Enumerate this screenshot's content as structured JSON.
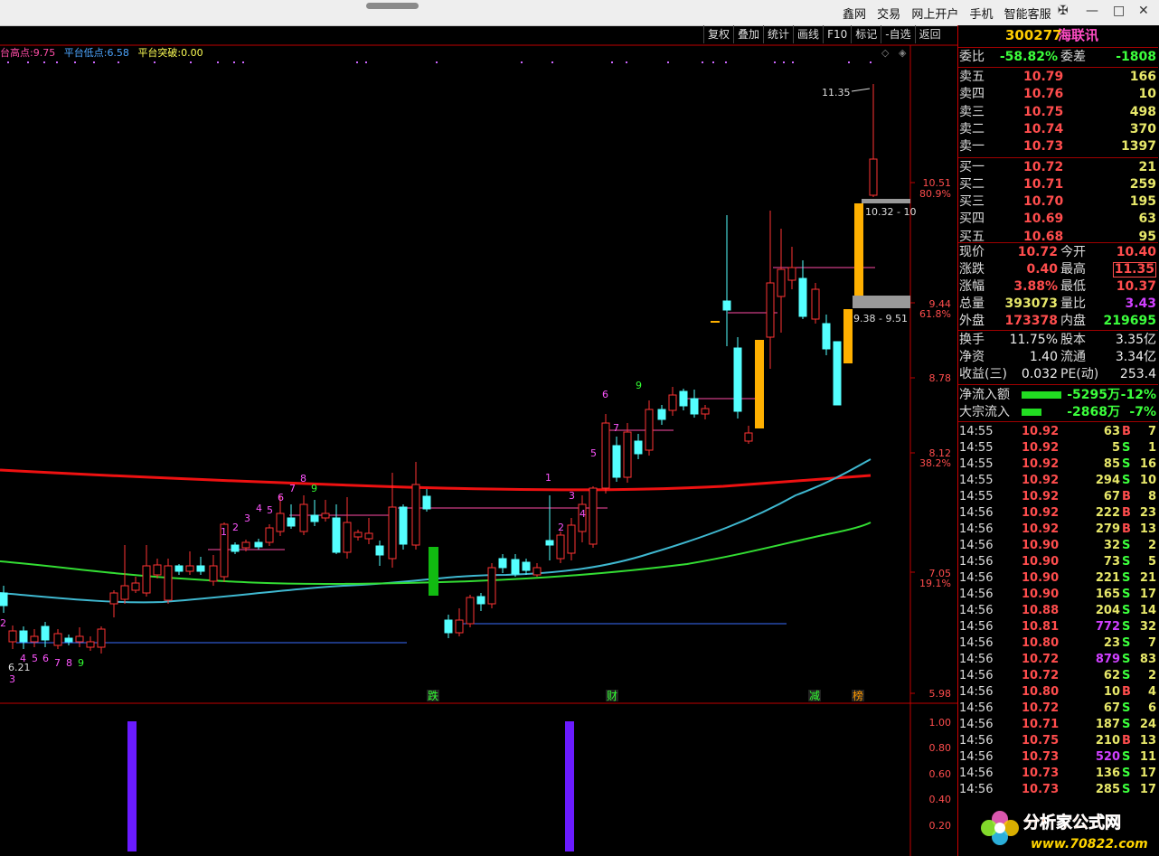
{
  "top_menu": [
    "鑫网",
    "交易",
    "网上开户",
    "手机",
    "智能客服"
  ],
  "window_buttons": {
    "pin": "pin-icon",
    "minimize": "minimize-icon",
    "maximize": "maximize-icon",
    "close": "close-icon"
  },
  "toolbar": [
    "复权",
    "叠加",
    "统计",
    "画线",
    "F10",
    "标记",
    "-自选",
    "返回"
  ],
  "indicator_header": {
    "high_label": "台高点:",
    "high_value": "9.75",
    "low_label": "平台低点:",
    "low_value": "6.58",
    "break_label": "平台突破:",
    "break_value": "0.00"
  },
  "price_axis": [
    {
      "value": "10.51",
      "pct": "80.9%"
    },
    {
      "value": "9.44",
      "pct": "61.8%"
    },
    {
      "value": "8.78",
      "pct": ""
    },
    {
      "value": "8.12",
      "pct": "38.2%"
    },
    {
      "value": "7.05",
      "pct": "19.1%"
    },
    {
      "value": "5.98",
      "pct": ""
    }
  ],
  "sub_axis": [
    "1.00",
    "0.80",
    "0.60",
    "0.40",
    "0.20"
  ],
  "annotations": {
    "high": "11.35",
    "low": "6.21",
    "box_upper": "10.32 - 10",
    "box_lower": "9.38 - 9.51"
  },
  "markers": [
    {
      "text": "跌",
      "color": "#33ff33"
    },
    {
      "text": "财",
      "color": "#33ff33"
    },
    {
      "text": "减",
      "color": "#33ff33"
    },
    {
      "text": "榜",
      "color": "#ff9900"
    }
  ],
  "seq_labels": [
    "2",
    "3",
    "4",
    "5",
    "6",
    "7",
    "8",
    "9",
    "1",
    "2",
    "3",
    "4",
    "5",
    "6",
    "7",
    "8",
    "9",
    "1",
    "2",
    "3",
    "4",
    "5",
    "6",
    "7",
    "9"
  ],
  "stock": {
    "code": "300277",
    "name": "海联讯"
  },
  "weibi": {
    "label1": "委比",
    "value1": "-58.82%",
    "label2": "委差",
    "value2": "-1808"
  },
  "asks": [
    {
      "label": "卖五",
      "price": "10.79",
      "vol": "166"
    },
    {
      "label": "卖四",
      "price": "10.76",
      "vol": "10"
    },
    {
      "label": "卖三",
      "price": "10.75",
      "vol": "498"
    },
    {
      "label": "卖二",
      "price": "10.74",
      "vol": "370"
    },
    {
      "label": "卖一",
      "price": "10.73",
      "vol": "1397"
    }
  ],
  "bids": [
    {
      "label": "买一",
      "price": "10.72",
      "vol": "21"
    },
    {
      "label": "买二",
      "price": "10.71",
      "vol": "259"
    },
    {
      "label": "买三",
      "price": "10.70",
      "vol": "195"
    },
    {
      "label": "买四",
      "price": "10.69",
      "vol": "63"
    },
    {
      "label": "买五",
      "price": "10.68",
      "vol": "95"
    }
  ],
  "quote": [
    {
      "l1": "现价",
      "v1": "10.72",
      "c1": "red",
      "l2": "今开",
      "v2": "10.40",
      "c2": "red"
    },
    {
      "l1": "涨跌",
      "v1": "0.40",
      "c1": "red",
      "l2": "最高",
      "v2": "11.35",
      "c2": "red"
    },
    {
      "l1": "涨幅",
      "v1": "3.88%",
      "c1": "red",
      "l2": "最低",
      "v2": "10.37",
      "c2": "red"
    },
    {
      "l1": "总量",
      "v1": "393073",
      "c1": "yellow",
      "l2": "量比",
      "v2": "3.43",
      "c2": "purple"
    },
    {
      "l1": "外盘",
      "v1": "173378",
      "c1": "red",
      "l2": "内盘",
      "v2": "219695",
      "c2": "green"
    }
  ],
  "stats": [
    {
      "l1": "换手",
      "v1": "11.75%",
      "l2": "股本",
      "v2": "3.35亿"
    },
    {
      "l1": "净资",
      "v1": "1.40",
      "l2": "流通",
      "v2": "3.34亿"
    },
    {
      "l1": "收益(三)",
      "v1": "0.032",
      "l2": "PE(动)",
      "v2": "253.4"
    }
  ],
  "flows": [
    {
      "label": "净流入额",
      "amount": "-5295万",
      "pct": "-12%"
    },
    {
      "label": "大宗流入",
      "amount": "-2868万",
      "pct": "-7%"
    }
  ],
  "ticks": [
    {
      "t": "14:55",
      "p": "10.92",
      "v": "63",
      "s": "B",
      "n": "7"
    },
    {
      "t": "14:55",
      "p": "10.92",
      "v": "5",
      "s": "S",
      "n": "1"
    },
    {
      "t": "14:55",
      "p": "10.92",
      "v": "85",
      "s": "S",
      "n": "16"
    },
    {
      "t": "14:55",
      "p": "10.92",
      "v": "294",
      "s": "S",
      "n": "10"
    },
    {
      "t": "14:55",
      "p": "10.92",
      "v": "67",
      "s": "B",
      "n": "8"
    },
    {
      "t": "14:56",
      "p": "10.92",
      "v": "222",
      "s": "B",
      "n": "23"
    },
    {
      "t": "14:56",
      "p": "10.92",
      "v": "279",
      "s": "B",
      "n": "13"
    },
    {
      "t": "14:56",
      "p": "10.90",
      "v": "32",
      "s": "S",
      "n": "2"
    },
    {
      "t": "14:56",
      "p": "10.90",
      "v": "73",
      "s": "S",
      "n": "5"
    },
    {
      "t": "14:56",
      "p": "10.90",
      "v": "221",
      "s": "S",
      "n": "21"
    },
    {
      "t": "14:56",
      "p": "10.90",
      "v": "165",
      "s": "S",
      "n": "17"
    },
    {
      "t": "14:56",
      "p": "10.88",
      "v": "204",
      "s": "S",
      "n": "14"
    },
    {
      "t": "14:56",
      "p": "10.81",
      "v": "772",
      "s": "S",
      "n": "32"
    },
    {
      "t": "14:56",
      "p": "10.80",
      "v": "23",
      "s": "S",
      "n": "7"
    },
    {
      "t": "14:56",
      "p": "10.72",
      "v": "879",
      "s": "S",
      "n": "83"
    },
    {
      "t": "14:56",
      "p": "10.72",
      "v": "62",
      "s": "S",
      "n": "2"
    },
    {
      "t": "14:56",
      "p": "10.80",
      "v": "10",
      "s": "B",
      "n": "4"
    },
    {
      "t": "14:56",
      "p": "10.72",
      "v": "67",
      "s": "S",
      "n": "6"
    },
    {
      "t": "14:56",
      "p": "10.71",
      "v": "187",
      "s": "S",
      "n": "24"
    },
    {
      "t": "14:56",
      "p": "10.75",
      "v": "210",
      "s": "B",
      "n": "13"
    },
    {
      "t": "14:56",
      "p": "10.73",
      "v": "520",
      "s": "S",
      "n": "11"
    },
    {
      "t": "14:56",
      "p": "10.73",
      "v": "136",
      "s": "S",
      "n": "17"
    },
    {
      "t": "14:56",
      "p": "10.73",
      "v": "285",
      "s": "S",
      "n": "17"
    }
  ],
  "watermark": {
    "title": "分析家公式网",
    "url": "www.70822.com"
  },
  "colors": {
    "up": "#ff3333",
    "down": "#54ffff",
    "ma_long": "#ff1a1a",
    "ma_mid": "#3fb8d0",
    "ma_short": "#33dd33",
    "signal_bar": "#6a1bff",
    "golden": "#ffb000"
  }
}
